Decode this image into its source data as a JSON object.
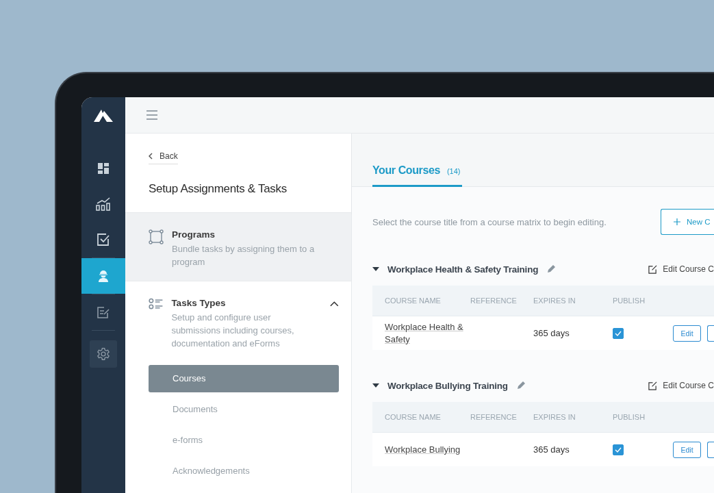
{
  "sidebar": {
    "items": [
      {
        "kind": "dashboard",
        "selected": false,
        "focused": false
      },
      {
        "kind": "chart",
        "selected": false,
        "focused": false
      },
      {
        "kind": "checkbox",
        "selected": false,
        "focused": false
      },
      {
        "kind": "worker",
        "selected": true,
        "focused": false
      },
      {
        "kind": "edit",
        "selected": false,
        "focused": false
      },
      {
        "kind": "settings",
        "selected": false,
        "focused": true
      }
    ]
  },
  "panel": {
    "back": "Back",
    "title": "Setup Assignments & Tasks",
    "sections": [
      {
        "kind": "programs",
        "title": "Programs",
        "description": "Bundle tasks by assigning them to a program",
        "highlighted": true
      },
      {
        "kind": "tasks",
        "title": "Tasks Types",
        "description": "Setup and configure user submissions including courses, documentation and eForms",
        "highlighted": false,
        "expanded": true,
        "children": [
          {
            "label": "Courses",
            "selected": true
          },
          {
            "label": "Documents",
            "selected": false
          },
          {
            "label": "e-forms",
            "selected": false
          },
          {
            "label": "Acknowledgements",
            "selected": false
          }
        ]
      }
    ]
  },
  "main": {
    "tab": {
      "label": "Your Courses",
      "count": "(14)",
      "selected": true
    },
    "instruction": "Select the course title from a course matrix to begin editing.",
    "new_button": "New C",
    "groups": [
      {
        "title": "Workplace Health & Safety Training",
        "edit_label": "Edit Course C",
        "expanded": true,
        "columns": [
          "COURSE NAME",
          "REFERENCE",
          "EXPIRES IN",
          "PUBLISH"
        ],
        "rows": [
          {
            "course_name": "Workplace Health & Safety",
            "expires": "365 days",
            "published": true,
            "action": "Edit"
          }
        ]
      },
      {
        "title": "Workplace Bullying Training",
        "edit_label": "Edit Course C",
        "expanded": true,
        "columns": [
          "COURSE NAME",
          "REFERENCE",
          "EXPIRES IN",
          "PUBLISH"
        ],
        "rows": [
          {
            "course_name": "Workplace Bullying",
            "expires": "365 days",
            "published": true,
            "action": "Edit"
          }
        ]
      }
    ]
  }
}
